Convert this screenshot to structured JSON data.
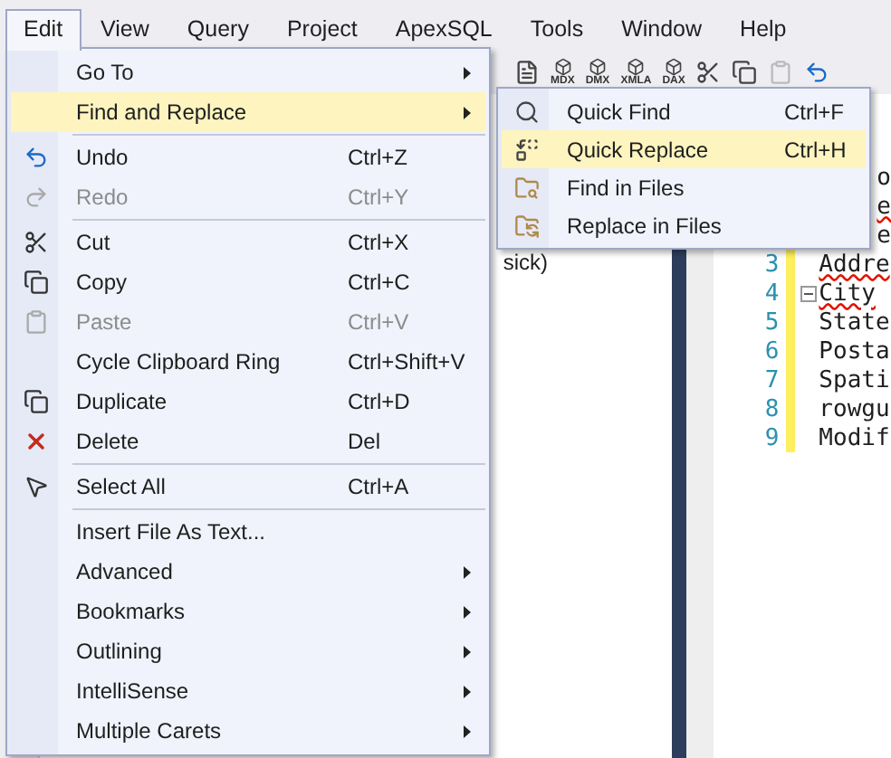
{
  "menu_bar": [
    {
      "label": "Edit",
      "selected": true
    },
    {
      "label": "View",
      "selected": false
    },
    {
      "label": "Query",
      "selected": false
    },
    {
      "label": "Project",
      "selected": false
    },
    {
      "label": "ApexSQL",
      "selected": false
    },
    {
      "label": "Tools",
      "selected": false
    },
    {
      "label": "Window",
      "selected": false
    },
    {
      "label": "Help",
      "selected": false
    }
  ],
  "toolbar": {
    "cube_labels": [
      "MDX",
      "DMX",
      "XMLA",
      "DAX"
    ]
  },
  "left_panel": {
    "text": "sick)"
  },
  "editor": {
    "lines": [
      {
        "kind": "fragment",
        "text": "o",
        "squiggle": false
      },
      {
        "kind": "fragment",
        "text": "e",
        "squiggle": true
      },
      {
        "kind": "fragment",
        "text": "e",
        "squiggle": false
      },
      {
        "kind": "line",
        "number": "3",
        "text": "Addre",
        "squiggle": true,
        "collapsible": false
      },
      {
        "kind": "line",
        "number": "4",
        "text": "City",
        "squiggle": true,
        "collapsible": true
      },
      {
        "kind": "line",
        "number": "5",
        "text": "State",
        "squiggle": false,
        "collapsible": false
      },
      {
        "kind": "line",
        "number": "6",
        "text": "Posta",
        "squiggle": false,
        "collapsible": false
      },
      {
        "kind": "line",
        "number": "7",
        "text": "Spati",
        "squiggle": false,
        "collapsible": false
      },
      {
        "kind": "line",
        "number": "8",
        "text": "rowgu",
        "squiggle": false,
        "collapsible": false
      },
      {
        "kind": "line",
        "number": "9",
        "text": "Modif",
        "squiggle": false,
        "collapsible": false
      }
    ]
  },
  "edit_menu": {
    "items": [
      {
        "kind": "item",
        "label": "Go To",
        "disabled": false,
        "selected": false,
        "submenu": true
      },
      {
        "kind": "item",
        "label": "Find and Replace",
        "disabled": false,
        "selected": true,
        "submenu": true
      },
      {
        "kind": "separator"
      },
      {
        "kind": "item",
        "label": "Undo",
        "shortcut": "Ctrl+Z",
        "disabled": false,
        "selected": false,
        "submenu": false
      },
      {
        "kind": "item",
        "label": "Redo",
        "shortcut": "Ctrl+Y",
        "disabled": true,
        "selected": false,
        "submenu": false
      },
      {
        "kind": "separator"
      },
      {
        "kind": "item",
        "label": "Cut",
        "shortcut": "Ctrl+X",
        "disabled": false,
        "selected": false,
        "submenu": false
      },
      {
        "kind": "item",
        "label": "Copy",
        "shortcut": "Ctrl+C",
        "disabled": false,
        "selected": false,
        "submenu": false
      },
      {
        "kind": "item",
        "label": "Paste",
        "shortcut": "Ctrl+V",
        "disabled": true,
        "selected": false,
        "submenu": false
      },
      {
        "kind": "item",
        "label": "Cycle Clipboard Ring",
        "shortcut": "Ctrl+Shift+V",
        "disabled": false,
        "selected": false,
        "submenu": false
      },
      {
        "kind": "item",
        "label": "Duplicate",
        "shortcut": "Ctrl+D",
        "disabled": false,
        "selected": false,
        "submenu": false
      },
      {
        "kind": "item",
        "label": "Delete",
        "shortcut": "Del",
        "disabled": false,
        "selected": false,
        "submenu": false
      },
      {
        "kind": "separator"
      },
      {
        "kind": "item",
        "label": "Select All",
        "shortcut": "Ctrl+A",
        "disabled": false,
        "selected": false,
        "submenu": false
      },
      {
        "kind": "separator"
      },
      {
        "kind": "item",
        "label": "Insert File As Text...",
        "disabled": false,
        "selected": false,
        "submenu": false
      },
      {
        "kind": "item",
        "label": "Advanced",
        "disabled": false,
        "selected": false,
        "submenu": true
      },
      {
        "kind": "item",
        "label": "Bookmarks",
        "disabled": false,
        "selected": false,
        "submenu": true
      },
      {
        "kind": "item",
        "label": "Outlining",
        "disabled": false,
        "selected": false,
        "submenu": true
      },
      {
        "kind": "item",
        "label": "IntelliSense",
        "disabled": false,
        "selected": false,
        "submenu": true
      },
      {
        "kind": "item",
        "label": "Multiple Carets",
        "disabled": false,
        "selected": false,
        "submenu": true
      }
    ]
  },
  "find_replace_menu": {
    "items": [
      {
        "label": "Quick Find",
        "shortcut": "Ctrl+F",
        "selected": false
      },
      {
        "label": "Quick Replace",
        "shortcut": "Ctrl+H",
        "selected": true
      },
      {
        "label": "Find in Files",
        "selected": false
      },
      {
        "label": "Replace in Files",
        "selected": false
      }
    ]
  }
}
